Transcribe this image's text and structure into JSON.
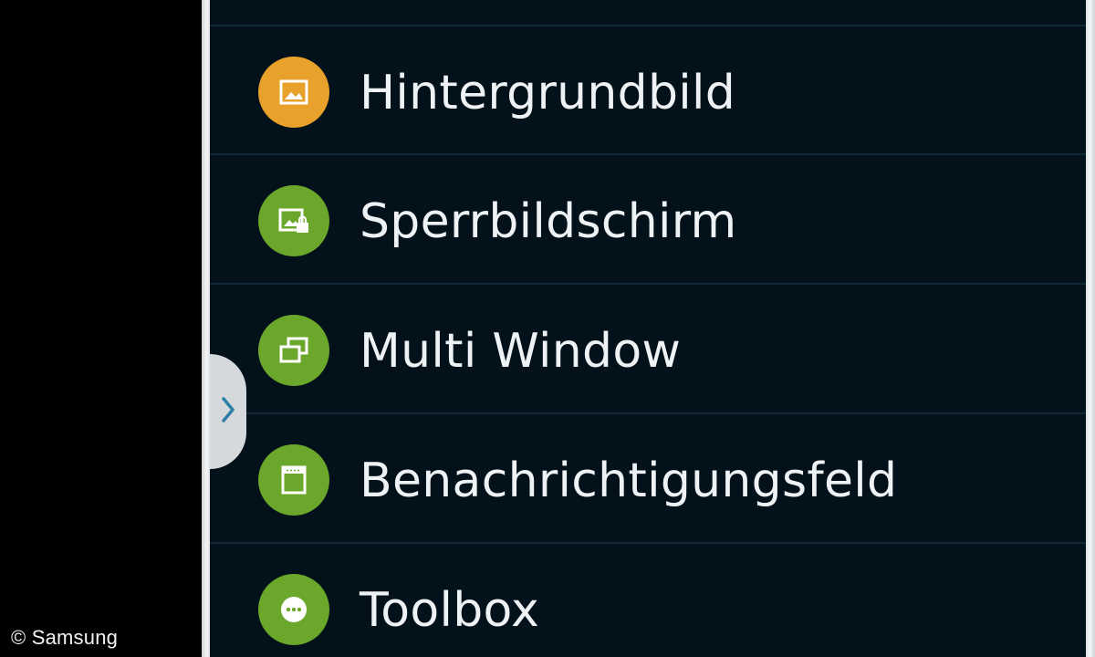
{
  "copyright": "© Samsung",
  "menu": {
    "items": [
      {
        "label": "Hintergrundbild",
        "icon": "wallpaper-icon",
        "color": "#e8a12a"
      },
      {
        "label": "Sperrbildschirm",
        "icon": "lock-screen-icon",
        "color": "#6aa72a"
      },
      {
        "label": "Multi Window",
        "icon": "multi-window-icon",
        "color": "#6aa72a"
      },
      {
        "label": "Benachrichtigungsfeld",
        "icon": "notification-panel-icon",
        "color": "#6aa72a"
      },
      {
        "label": "Toolbox",
        "icon": "toolbox-icon",
        "color": "#6aa72a"
      }
    ]
  },
  "handle": {
    "icon": "chevron-right-icon"
  }
}
